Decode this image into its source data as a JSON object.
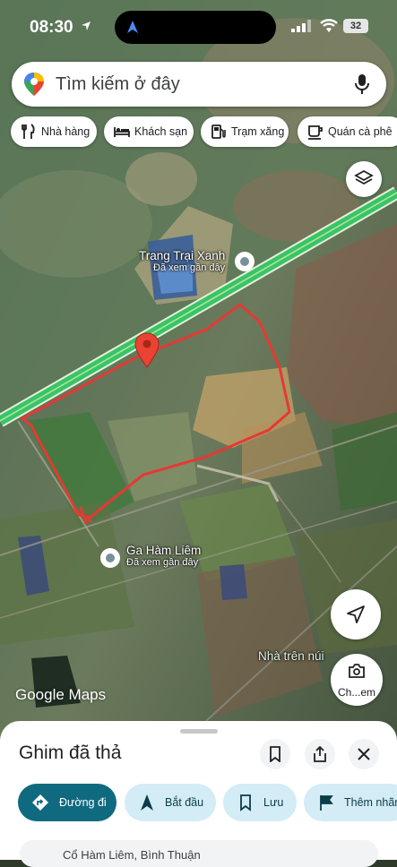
{
  "status_bar": {
    "time": "08:30",
    "battery": "32"
  },
  "search": {
    "placeholder": "Tìm kiếm ở đây"
  },
  "chips": [
    {
      "label": "Nhà hàng",
      "icon": "fork-knife-icon"
    },
    {
      "label": "Khách sạn",
      "icon": "bed-icon"
    },
    {
      "label": "Trạm xăng",
      "icon": "fuel-icon"
    },
    {
      "label": "Quán cà phê",
      "icon": "coffee-icon"
    }
  ],
  "places": [
    {
      "name": "Trang Trại Xanh",
      "note": "Đã xem gần đây"
    },
    {
      "name": "Ga Hàm Liêm",
      "note": "Đã xem gần đây"
    },
    {
      "name": "Nhà trên núi"
    }
  ],
  "map_controls": {
    "street_view_label": "Ch...em"
  },
  "attribution": {
    "text": "Google Maps"
  },
  "sheet": {
    "title": "Ghim đã thả",
    "actions": [
      {
        "label": "Đường đi",
        "icon": "directions-icon"
      },
      {
        "label": "Bắt đầu",
        "icon": "navigation-icon"
      },
      {
        "label": "Lưu",
        "icon": "bookmark-icon"
      },
      {
        "label": "Thêm nhãn",
        "icon": "flag-icon"
      }
    ],
    "address": "Cổ Hàm Liêm, Bình Thuận"
  },
  "colors": {
    "route": "#e53935",
    "highway": "#39c46a",
    "accent": "#0f6a80",
    "action_bg": "#d3ecf5"
  }
}
